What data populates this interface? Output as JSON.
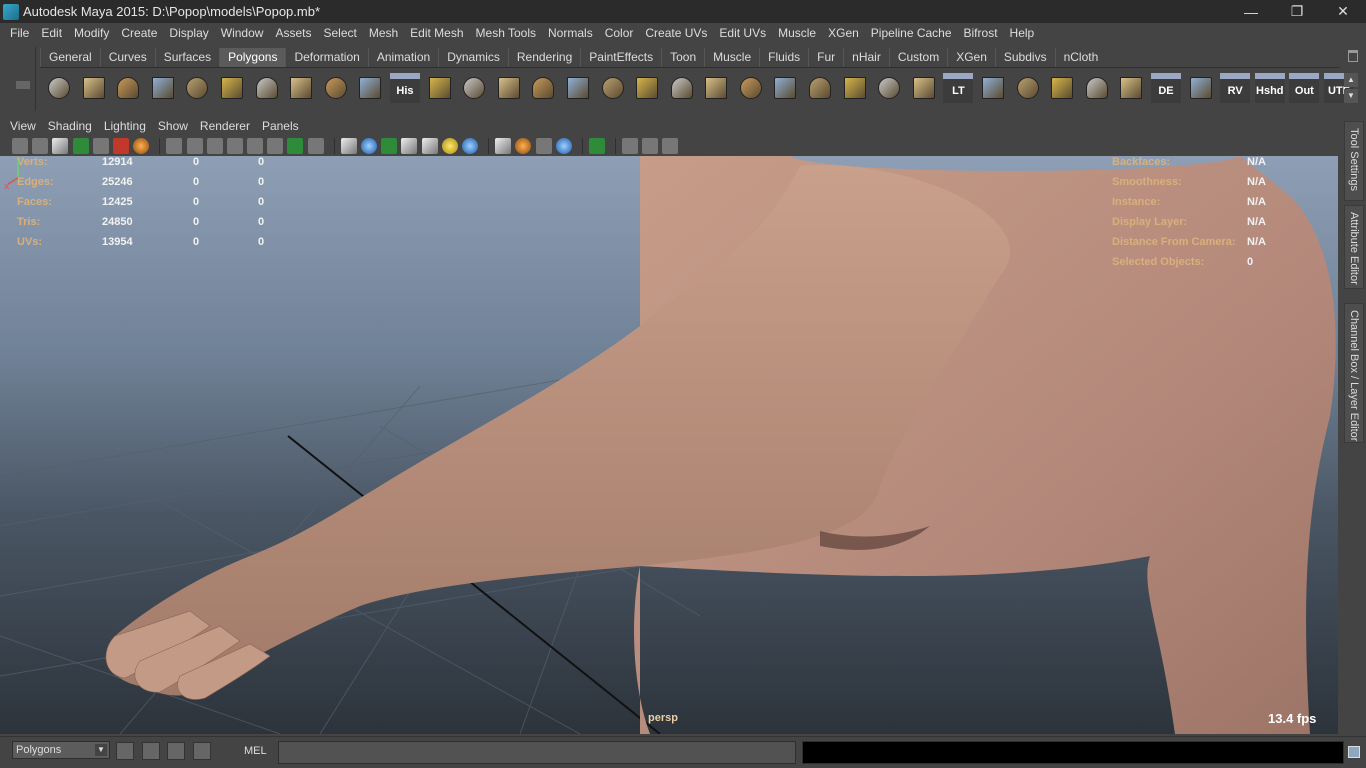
{
  "window": {
    "title": "Autodesk Maya 2015: D:\\Popop\\models\\Popop.mb*",
    "minimize": "—",
    "maximize": "❐",
    "close": "✕"
  },
  "menubar": [
    "File",
    "Edit",
    "Modify",
    "Create",
    "Display",
    "Window",
    "Assets",
    "Select",
    "Mesh",
    "Edit Mesh",
    "Mesh Tools",
    "Normals",
    "Color",
    "Create UVs",
    "Edit UVs",
    "Muscle",
    "XGen",
    "Pipeline Cache",
    "Bifrost",
    "Help"
  ],
  "shelf": {
    "tabs": [
      "General",
      "Curves",
      "Surfaces",
      "Polygons",
      "Deformation",
      "Animation",
      "Dynamics",
      "Rendering",
      "PaintEffects",
      "Toon",
      "Muscle",
      "Fluids",
      "Fur",
      "nHair",
      "Custom",
      "XGen",
      "Subdivs",
      "nCloth"
    ],
    "active_tab": "Polygons",
    "icons": [
      {
        "name": "poly-sphere-icon",
        "label": ""
      },
      {
        "name": "poly-cube-icon",
        "label": ""
      },
      {
        "name": "poly-cylinder-icon",
        "label": ""
      },
      {
        "name": "poly-cone-icon",
        "label": ""
      },
      {
        "name": "poly-plane-icon",
        "label": ""
      },
      {
        "name": "poly-torus-icon",
        "label": ""
      },
      {
        "name": "poly-pyramid-icon",
        "label": ""
      },
      {
        "name": "poly-pipe-icon",
        "label": ""
      },
      {
        "name": "poly-helix-icon",
        "label": ""
      },
      {
        "name": "poly-soccer-ball-icon",
        "label": ""
      },
      {
        "name": "history-icon",
        "label": "His"
      },
      {
        "name": "extrude-icon",
        "label": ""
      },
      {
        "name": "bridge-icon",
        "label": ""
      },
      {
        "name": "append-polygon-icon",
        "label": ""
      },
      {
        "name": "split-polygon-icon",
        "label": ""
      },
      {
        "name": "insert-edge-loop-icon",
        "label": ""
      },
      {
        "name": "offset-edge-loop-icon",
        "label": ""
      },
      {
        "name": "merge-icon",
        "label": ""
      },
      {
        "name": "combine-icon",
        "label": ""
      },
      {
        "name": "bevel-icon",
        "label": ""
      },
      {
        "name": "sculpt-icon",
        "label": ""
      },
      {
        "name": "paint-icon",
        "label": ""
      },
      {
        "name": "wireframe-icon",
        "label": ""
      },
      {
        "name": "pivot-icon",
        "label": ""
      },
      {
        "name": "transform-icon",
        "label": ""
      },
      {
        "name": "light-icon",
        "label": ""
      },
      {
        "name": "lt-icon",
        "label": "LT"
      },
      {
        "name": "uv-map-icon",
        "label": ""
      },
      {
        "name": "uv-unfold-icon",
        "label": ""
      },
      {
        "name": "uv-layout-icon",
        "label": ""
      },
      {
        "name": "uv-select-icon",
        "label": ""
      },
      {
        "name": "uv-cut-icon",
        "label": ""
      },
      {
        "name": "de-icon",
        "label": "DE"
      },
      {
        "name": "uv-grid-icon",
        "label": ""
      },
      {
        "name": "rv-icon",
        "label": "RV"
      },
      {
        "name": "hshd-icon",
        "label": "Hshd"
      },
      {
        "name": "out-icon",
        "label": "Out"
      },
      {
        "name": "ute-icon",
        "label": "UTE"
      }
    ]
  },
  "panel_menu": [
    "View",
    "Shading",
    "Lighting",
    "Show",
    "Renderer",
    "Panels"
  ],
  "hud_left": [
    {
      "label": "Verts:",
      "v1": "12914",
      "v2": "0",
      "v3": "0"
    },
    {
      "label": "Edges:",
      "v1": "25246",
      "v2": "0",
      "v3": "0"
    },
    {
      "label": "Faces:",
      "v1": "12425",
      "v2": "0",
      "v3": "0"
    },
    {
      "label": "Tris:",
      "v1": "24850",
      "v2": "0",
      "v3": "0"
    },
    {
      "label": "UVs:",
      "v1": "13954",
      "v2": "0",
      "v3": "0"
    }
  ],
  "hud_right": [
    {
      "label": "Backfaces:",
      "value": "N/A"
    },
    {
      "label": "Smoothness:",
      "value": "N/A"
    },
    {
      "label": "Instance:",
      "value": "N/A"
    },
    {
      "label": "Display Layer:",
      "value": "N/A"
    },
    {
      "label": "Distance From Camera:",
      "value": "N/A"
    },
    {
      "label": "Selected Objects:",
      "value": "0"
    }
  ],
  "viewport": {
    "camera": "persp",
    "fps": "13.4 fps",
    "axis_x": "x",
    "axis_y": "y"
  },
  "side_tabs": [
    "Tool Settings",
    "Attribute Editor",
    "Channel Box / Layer Editor"
  ],
  "cmdbar": {
    "mode": "Polygons",
    "mel": "MEL"
  },
  "colors": {
    "skin": "#b88f7d",
    "hud_label": "#d9b07a",
    "viewport_top": "#8e9fb5",
    "viewport_bottom": "#2c333b"
  }
}
